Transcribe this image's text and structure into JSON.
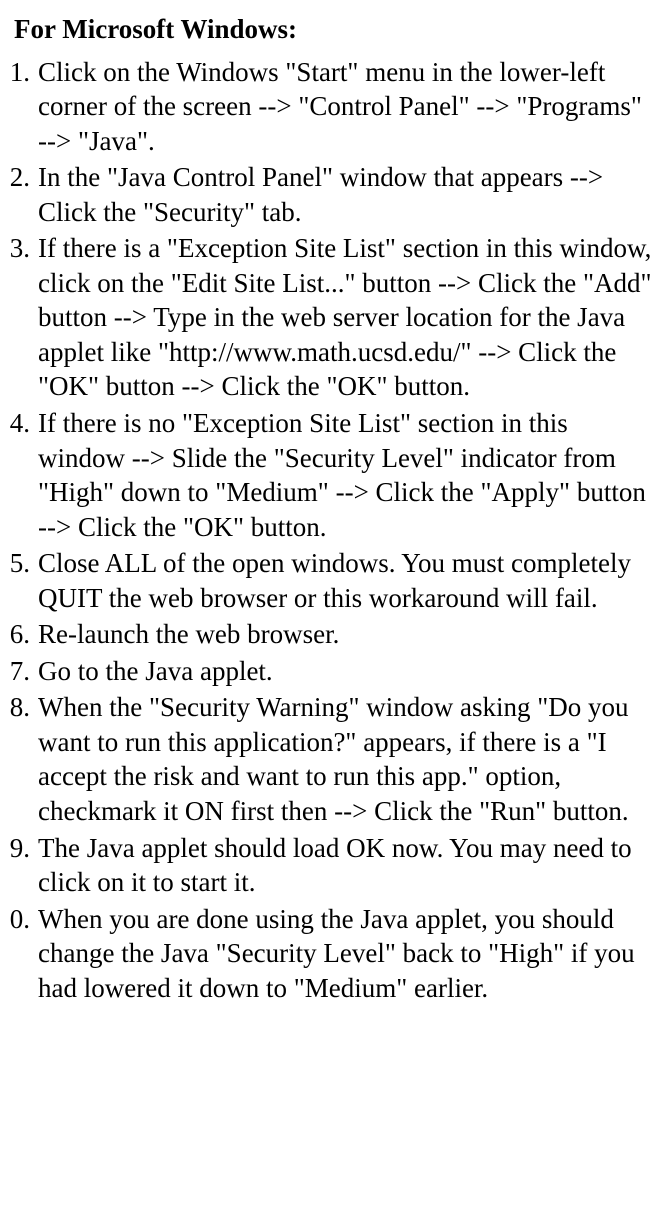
{
  "heading": "For Microsoft Windows:",
  "steps": [
    {
      "num": "1.",
      "text": "Click on the Windows \"Start\" menu in the lower-left corner of the screen --> \"Control Panel\" --> \"Programs\" --> \"Java\"."
    },
    {
      "num": "2.",
      "text": "In the \"Java Control Panel\" window that appears --> Click the \"Security\" tab."
    },
    {
      "num": "3.",
      "text": "If there is a \"Exception Site List\" section in this window, click on the \"Edit Site List...\" button --> Click the \"Add\" button --> Type in the web server location for the Java applet like \"http://www.math.ucsd.edu/\" --> Click the \"OK\" button --> Click the \"OK\" button."
    },
    {
      "num": "4.",
      "text": "If there is no \"Exception Site List\" section in this window --> Slide the \"Security Level\" indicator from \"High\" down to \"Medium\" --> Click the \"Apply\" button --> Click the \"OK\" button."
    },
    {
      "num": "5.",
      "text": "Close ALL of the open windows. You must completely QUIT the web browser or this workaround will fail."
    },
    {
      "num": "6.",
      "text": "Re-launch the web browser."
    },
    {
      "num": "7.",
      "text": "Go to the Java applet."
    },
    {
      "num": "8.",
      "text": "When the \"Security Warning\" window asking \"Do you want to run this application?\" appears, if there is a \"I accept the risk and want to run this app.\" option, checkmark it ON first then --> Click the \"Run\" button."
    },
    {
      "num": "9.",
      "text": "The Java applet should load OK now. You may need to click on it to start it."
    },
    {
      "num": "0.",
      "text": "When you are done using the Java applet, you should change the Java \"Security Level\" back to \"High\" if you had lowered it down to \"Medium\" earlier."
    }
  ]
}
